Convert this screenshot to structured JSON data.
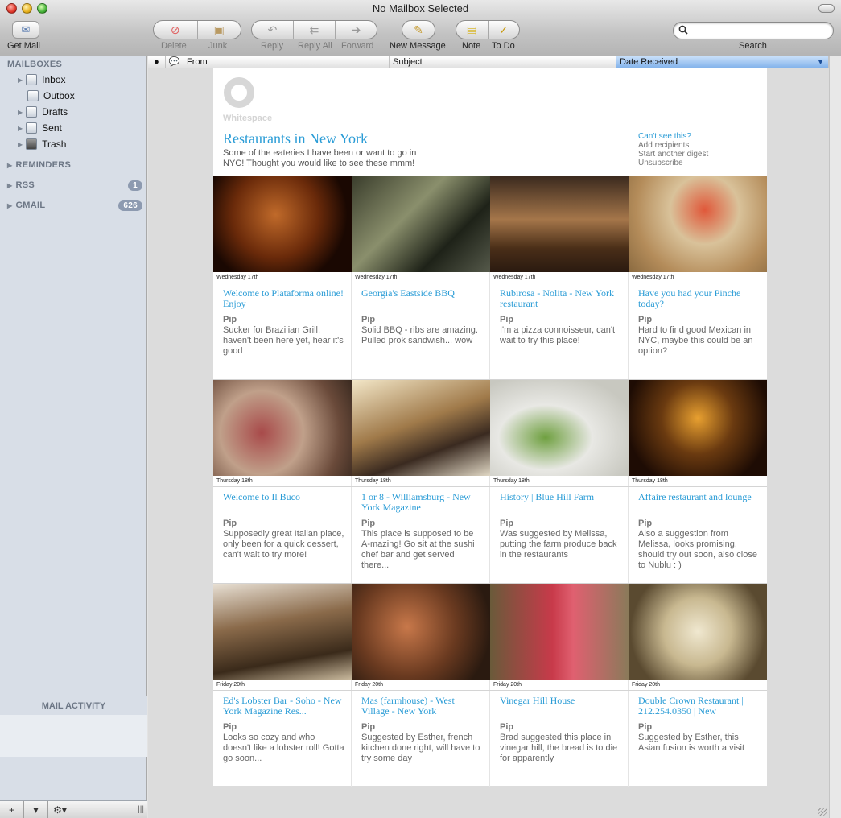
{
  "window": {
    "title": "No Mailbox Selected"
  },
  "toolbar": {
    "get_mail": "Get Mail",
    "delete": "Delete",
    "junk": "Junk",
    "reply": "Reply",
    "reply_all": "Reply All",
    "forward": "Forward",
    "new_message": "New Message",
    "note": "Note",
    "todo": "To Do",
    "search_label": "Search",
    "search_value": ""
  },
  "sidebar": {
    "mailboxes_header": "MAILBOXES",
    "mailboxes": [
      {
        "label": "Inbox"
      },
      {
        "label": "Outbox"
      },
      {
        "label": "Drafts"
      },
      {
        "label": "Sent"
      },
      {
        "label": "Trash"
      }
    ],
    "reminders": "REMINDERS",
    "rss": "RSS",
    "rss_count": "1",
    "gmail": "GMAIL",
    "gmail_count": "626",
    "activity": "MAIL ACTIVITY"
  },
  "columns": {
    "from": "From",
    "subject": "Subject",
    "date": "Date Received"
  },
  "email": {
    "logo_text": "Whitespace",
    "title": "Restaurants in New York",
    "intro": "Some of the eateries I have been or want to go in NYC! Thought you would like to see these mmm!",
    "links": [
      "Can't see this?",
      "Add recipients",
      "Start another digest",
      "Unsubscribe"
    ],
    "cards": [
      {
        "date": "Wednesday 17th",
        "title": "Welcome to Plataforma online! Enjoy",
        "author": "Pip",
        "body": "Sucker for Brazilian Grill, haven't been here yet, hear it's good"
      },
      {
        "date": "Wednesday 17th",
        "title": "Georgia's Eastside BBQ",
        "author": "Pip",
        "body": "Solid BBQ - ribs are amazing. Pulled prok sandwish... wow"
      },
      {
        "date": "Wednesday 17th",
        "title": "Rubirosa - Nolita - New York restaurant",
        "author": "Pip",
        "body": "I'm a pizza connoisseur, can't wait to try this place!"
      },
      {
        "date": "Wednesday 17th",
        "title": "Have you had your Pinche today?",
        "author": "Pip",
        "body": "Hard to find good Mexican in NYC, maybe this could be an option?"
      },
      {
        "date": "Thursday 18th",
        "title": "Welcome to Il Buco",
        "author": "Pip",
        "body": "Supposedly great Italian place, only been for a quick dessert, can't wait to try more!"
      },
      {
        "date": "Thursday 18th",
        "title": "1 or 8 - Williamsburg - New York Magazine",
        "author": "Pip",
        "body": "This place is supposed to be A-mazing! Go sit at the sushi chef bar and get served there..."
      },
      {
        "date": "Thursday 18th",
        "title": "History | Blue Hill Farm",
        "author": "Pip",
        "body": "Was suggested by Melissa, putting the farm produce back in the restaurants"
      },
      {
        "date": "Thursday 18th",
        "title": "Affaire restaurant and  lounge",
        "author": "Pip",
        "body": "Also a suggestion from Melissa, looks promising, should try out soon, also close to Nublu : )"
      },
      {
        "date": "Friday 20th",
        "title": "Ed's Lobster Bar - Soho - New York Magazine Res...",
        "author": "Pip",
        "body": "Looks so cozy and who doesn't like a lobster roll! Gotta go soon..."
      },
      {
        "date": "Friday 20th",
        "title": "Mas (farmhouse) - West Village - New York",
        "author": "Pip",
        "body": "Suggested by Esther, french kitchen done right, will have to try some day"
      },
      {
        "date": "Friday 20th",
        "title": "Vinegar Hill House",
        "author": "Pip",
        "body": "Brad suggested this place in vinegar hill, the bread is to die for apparently"
      },
      {
        "date": "Friday 20th",
        "title": "Double Crown Restaurant | 212.254.0350 | New",
        "author": "Pip",
        "body": "Suggested by Esther, this Asian fusion is worth a visit"
      }
    ]
  },
  "colors": {
    "link_blue": "#2a9cd6",
    "sidebar_bg": "#d8dee7",
    "badge": "#8d9ab0"
  }
}
